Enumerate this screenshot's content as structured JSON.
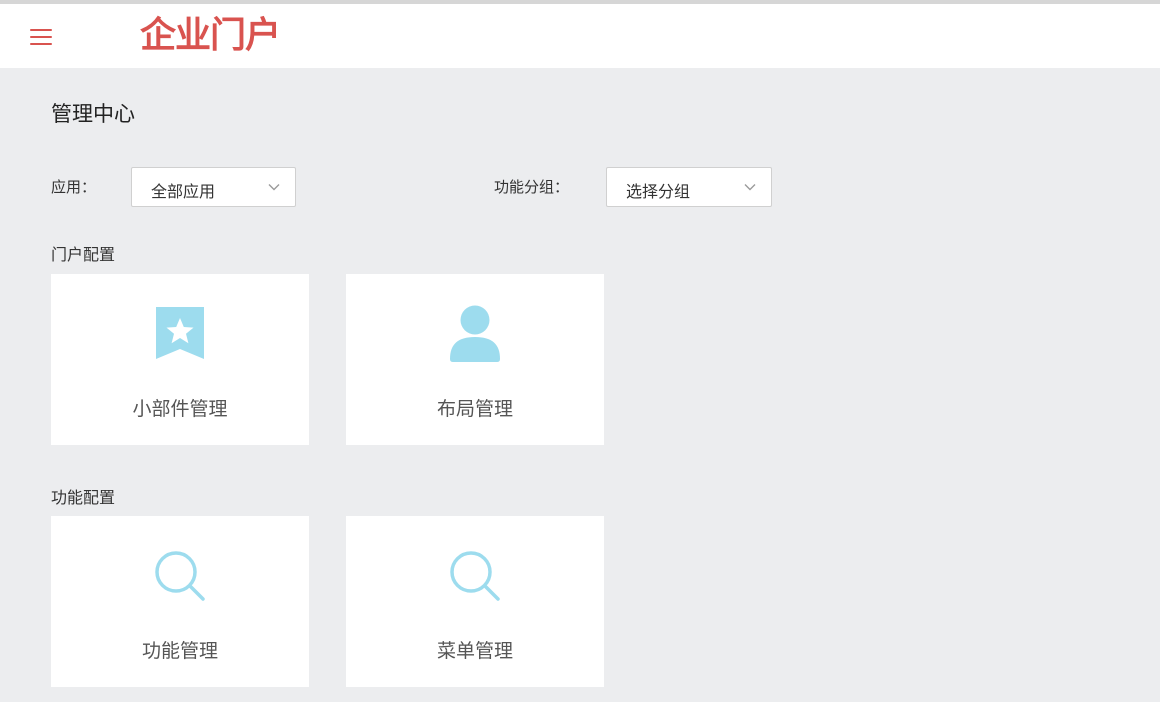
{
  "header": {
    "logo_text": "企业门户",
    "menu_icon": "hamburger-menu-icon",
    "accent_color": "#d9534f"
  },
  "page": {
    "title": "管理中心"
  },
  "filters": {
    "app_label": "应用：",
    "app_value": "全部应用",
    "group_label": "功能分组：",
    "group_value": "选择分组"
  },
  "sections": {
    "portal": {
      "label": "门户配置",
      "cards": [
        {
          "label": "小部件管理",
          "icon": "bookmark-star-icon"
        },
        {
          "label": "布局管理",
          "icon": "user-icon"
        }
      ]
    },
    "function": {
      "label": "功能配置",
      "cards": [
        {
          "label": "功能管理",
          "icon": "search-icon"
        },
        {
          "label": "菜单管理",
          "icon": "search-icon"
        }
      ]
    }
  },
  "colors": {
    "icon": "#9ddcee",
    "background": "#ecedef"
  }
}
